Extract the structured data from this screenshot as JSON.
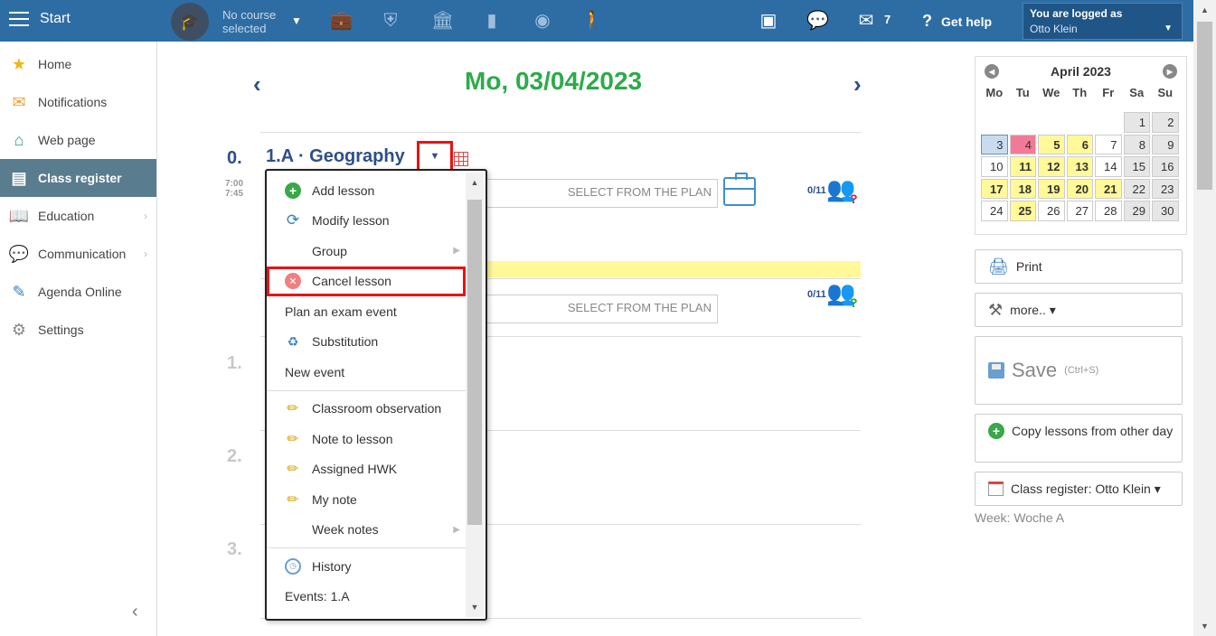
{
  "topbar": {
    "start_label": "Start",
    "course_line1": "No course",
    "course_line2": "selected",
    "message_count": "7",
    "help_label": "Get help",
    "user_line1": "You are logged as",
    "user_line2": "Otto Klein"
  },
  "sidebar": {
    "items": [
      {
        "label": "Home",
        "icon": "star-icon"
      },
      {
        "label": "Notifications",
        "icon": "envelope-icon"
      },
      {
        "label": "Web page",
        "icon": "house-icon"
      },
      {
        "label": "Class register",
        "icon": "notebook-icon"
      },
      {
        "label": "Education",
        "icon": "book-icon"
      },
      {
        "label": "Communication",
        "icon": "chat-icon"
      },
      {
        "label": "Agenda Online",
        "icon": "pen-icon"
      },
      {
        "label": "Settings",
        "icon": "gear-icon"
      }
    ]
  },
  "main": {
    "date_title": "Mo, 03/04/2023",
    "lesson0_num": "0.",
    "lesson0_title": "1.A · Geography",
    "time_start": "7:00",
    "time_end": "7:45",
    "plan_placeholder": "SELECT FROM THE PLAN",
    "attendance": "0/11",
    "lesson_nums": [
      "1.",
      "2.",
      "3."
    ]
  },
  "menu": {
    "items": [
      "Add lesson",
      "Modify lesson",
      "Group",
      "Cancel lesson",
      "Plan an exam event",
      "Substitution",
      "New event",
      "Classroom observation",
      "Note to lesson",
      "Assigned HWK",
      "My note",
      "Week notes",
      "History",
      "Events: 1.A"
    ]
  },
  "calendar": {
    "month": "April 2023",
    "dow": [
      "Mo",
      "Tu",
      "We",
      "Th",
      "Fr",
      "Sa",
      "Su"
    ],
    "days": [
      {
        "d": "",
        "c": "empty"
      },
      {
        "d": "",
        "c": "empty"
      },
      {
        "d": "",
        "c": "empty"
      },
      {
        "d": "",
        "c": "empty"
      },
      {
        "d": "",
        "c": "empty"
      },
      {
        "d": "1",
        "c": "wk"
      },
      {
        "d": "2",
        "c": "wk"
      },
      {
        "d": "3",
        "c": "sel"
      },
      {
        "d": "4",
        "c": "red"
      },
      {
        "d": "5",
        "c": "y"
      },
      {
        "d": "6",
        "c": "y"
      },
      {
        "d": "7",
        "c": ""
      },
      {
        "d": "8",
        "c": "wk"
      },
      {
        "d": "9",
        "c": "wk"
      },
      {
        "d": "10",
        "c": ""
      },
      {
        "d": "11",
        "c": "y"
      },
      {
        "d": "12",
        "c": "y"
      },
      {
        "d": "13",
        "c": "y"
      },
      {
        "d": "14",
        "c": ""
      },
      {
        "d": "15",
        "c": "wk"
      },
      {
        "d": "16",
        "c": "wk"
      },
      {
        "d": "17",
        "c": "y"
      },
      {
        "d": "18",
        "c": "y"
      },
      {
        "d": "19",
        "c": "y"
      },
      {
        "d": "20",
        "c": "y"
      },
      {
        "d": "21",
        "c": "y"
      },
      {
        "d": "22",
        "c": "wk"
      },
      {
        "d": "23",
        "c": "wk"
      },
      {
        "d": "24",
        "c": ""
      },
      {
        "d": "25",
        "c": "y"
      },
      {
        "d": "26",
        "c": ""
      },
      {
        "d": "27",
        "c": ""
      },
      {
        "d": "28",
        "c": ""
      },
      {
        "d": "29",
        "c": "wk"
      },
      {
        "d": "30",
        "c": "wk"
      }
    ]
  },
  "right": {
    "print_label": "Print",
    "more_label": "more.. ▾",
    "save_label": "Save",
    "save_hint": "(Ctrl+S)",
    "copy_label": "Copy lessons from other day",
    "register_label": "Class register: Otto Klein ▾",
    "week_label": "Week: Woche A"
  },
  "colors": {
    "topbar": "#2e6da4",
    "date_green": "#2eaa4b",
    "highlight_red": "#ee1111"
  }
}
